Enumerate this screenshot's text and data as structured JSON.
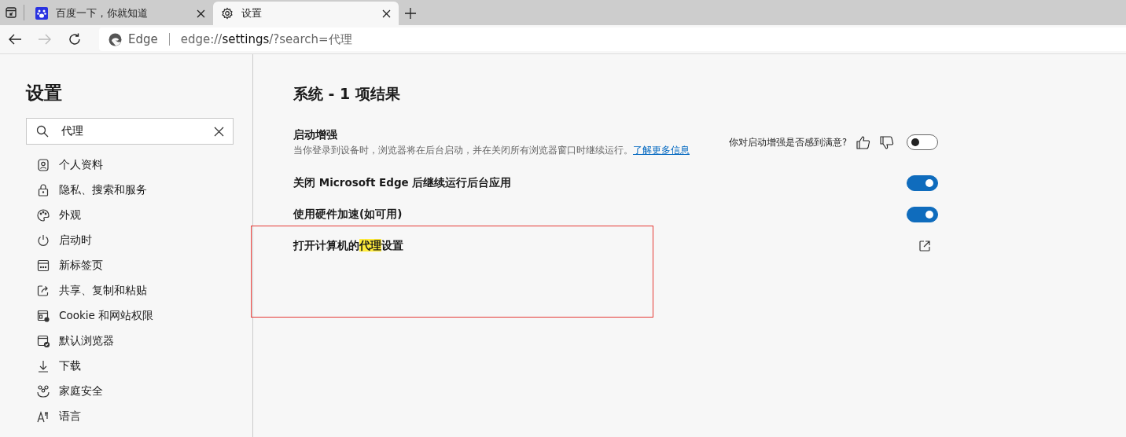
{
  "tabs": [
    {
      "title": "百度一下，你就知道",
      "selected": false
    },
    {
      "title": "设置",
      "selected": true
    }
  ],
  "address_bar": {
    "site_label": "Edge",
    "url_prefix": "edge://",
    "url_host": "settings",
    "url_rest": "/?search=代理"
  },
  "sidebar": {
    "title": "设置",
    "search": {
      "value": "代理"
    },
    "items": [
      {
        "label": "个人资料"
      },
      {
        "label": "隐私、搜索和服务"
      },
      {
        "label": "外观"
      },
      {
        "label": "启动时"
      },
      {
        "label": "新标签页"
      },
      {
        "label": "共享、复制和粘贴"
      },
      {
        "label": "Cookie 和网站权限"
      },
      {
        "label": "默认浏览器"
      },
      {
        "label": "下载"
      },
      {
        "label": "家庭安全"
      },
      {
        "label": "语言"
      }
    ]
  },
  "main": {
    "heading": "系统 - 1 项结果",
    "settings": [
      {
        "kind": "toggle",
        "title": "启动增强",
        "description": "当你登录到设备时，浏览器将在后台启动，并在关闭所有浏览器窗口时继续运行。",
        "link": "了解更多信息",
        "feedback": "你对启动增强是否感到满意?",
        "on": false
      },
      {
        "kind": "toggle",
        "title": "关闭 Microsoft Edge 后继续运行后台应用",
        "on": true
      },
      {
        "kind": "toggle",
        "title": "使用硬件加速(如可用)",
        "on": true
      },
      {
        "kind": "external",
        "title_before": "打开计算机的",
        "title_match": "代理",
        "title_after": "设置"
      }
    ]
  }
}
